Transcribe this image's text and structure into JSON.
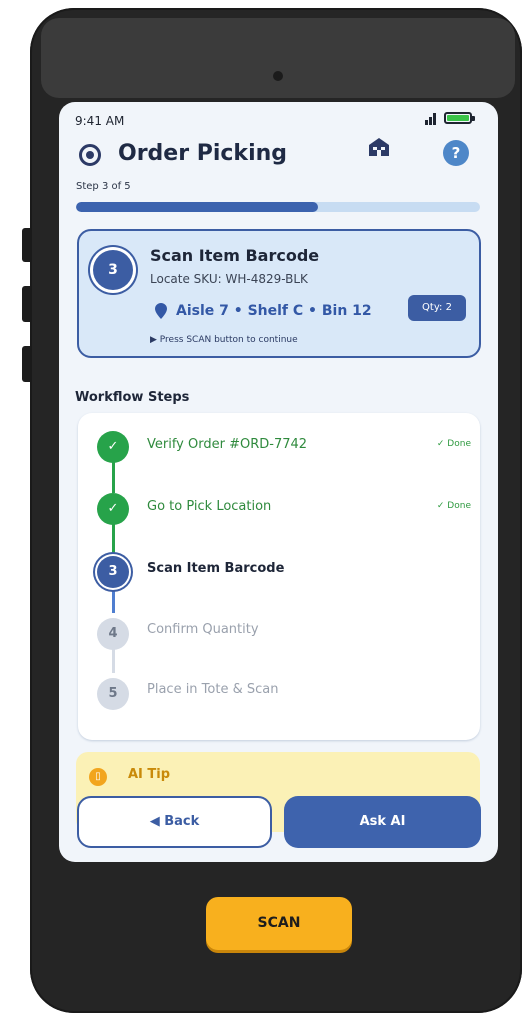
{
  "status_bar": {
    "time": "9:41 AM"
  },
  "header": {
    "title": "Order Picking",
    "logo_icon": "target-logo-icon",
    "home_icon": "warehouse-home-icon",
    "help_label": "?"
  },
  "progress": {
    "step_text": "Step 3 of 5",
    "fraction": 0.6,
    "fill_color": "#3c63ae",
    "track_color": "#c7dcf2"
  },
  "current_task": {
    "number": "3",
    "title": "Scan Item Barcode",
    "sku": "Locate SKU: WH-4829-BLK",
    "location": "Aisle 7 • Shelf C • Bin 12",
    "location_icon": "map-pin-icon",
    "qty": "Qty: 2",
    "hint": "▶ Press SCAN button to continue"
  },
  "workflow": {
    "title": "Workflow Steps",
    "steps": [
      {
        "num": "✓",
        "label": "Verify Order #ORD-7742",
        "status": "✓ Done",
        "state": "done"
      },
      {
        "num": "✓",
        "label": "Go to Pick Location",
        "status": "✓ Done",
        "state": "done"
      },
      {
        "num": "3",
        "label": "Scan Item Barcode",
        "status": "",
        "state": "active"
      },
      {
        "num": "4",
        "label": "Confirm Quantity",
        "status": "",
        "state": "pending"
      },
      {
        "num": "5",
        "label": "Place in Tote & Scan",
        "status": "",
        "state": "pending"
      }
    ]
  },
  "ai_tip": {
    "title": "AI Tip",
    "icon": "phone-ai-icon"
  },
  "buttons": {
    "back": "◀ Back",
    "ask_ai": "Ask AI",
    "scan": "SCAN"
  },
  "colors": {
    "primary": "#3c5da3",
    "success": "#27a34a",
    "warning": "#f8b01e"
  }
}
